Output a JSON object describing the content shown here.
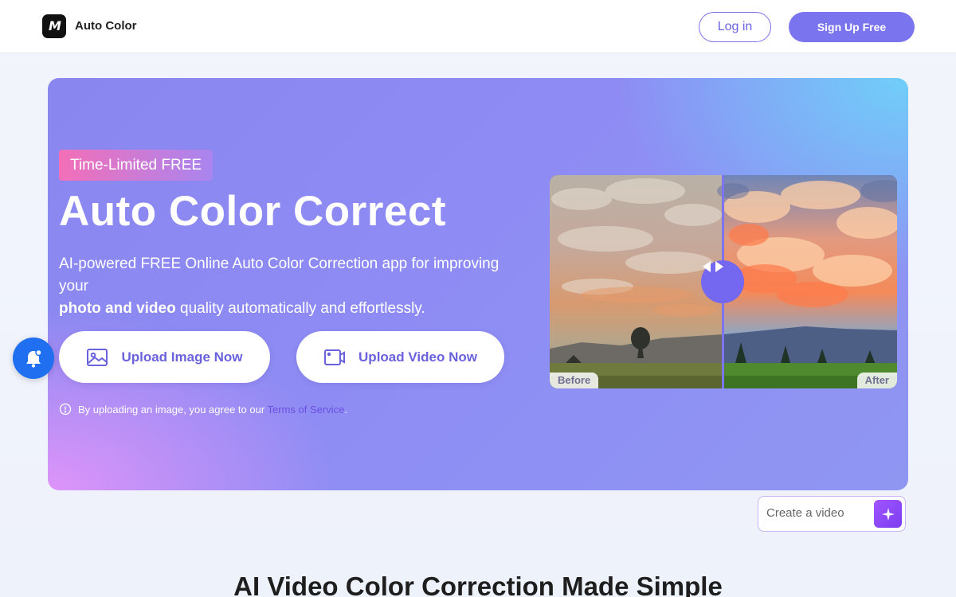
{
  "header": {
    "logo_text": "M",
    "app_name": "Auto Color",
    "login_label": "Log in",
    "signup_label": "Sign Up Free"
  },
  "hero": {
    "badge": "Time-Limited FREE",
    "title": "Auto Color Correct",
    "subtitle_plain": "AI-powered FREE Online Auto Color Correction app for improving your",
    "subtitle_bold": "photo and video",
    "subtitle_rest": " quality automatically and effortlessly.",
    "upload_image_label": "Upload Image Now",
    "upload_video_label": "Upload Video Now",
    "terms_text": "By uploading an image, you agree to our ",
    "terms_link": "Terms of Service",
    "terms_end": "."
  },
  "compare": {
    "before_label": "Before",
    "after_label": "After"
  },
  "create": {
    "placeholder": "Create a video"
  },
  "section": {
    "title": "AI Video Color Correction Made Simple"
  },
  "colors": {
    "accent": "#7a74ef",
    "bell": "#1f6ff0"
  }
}
